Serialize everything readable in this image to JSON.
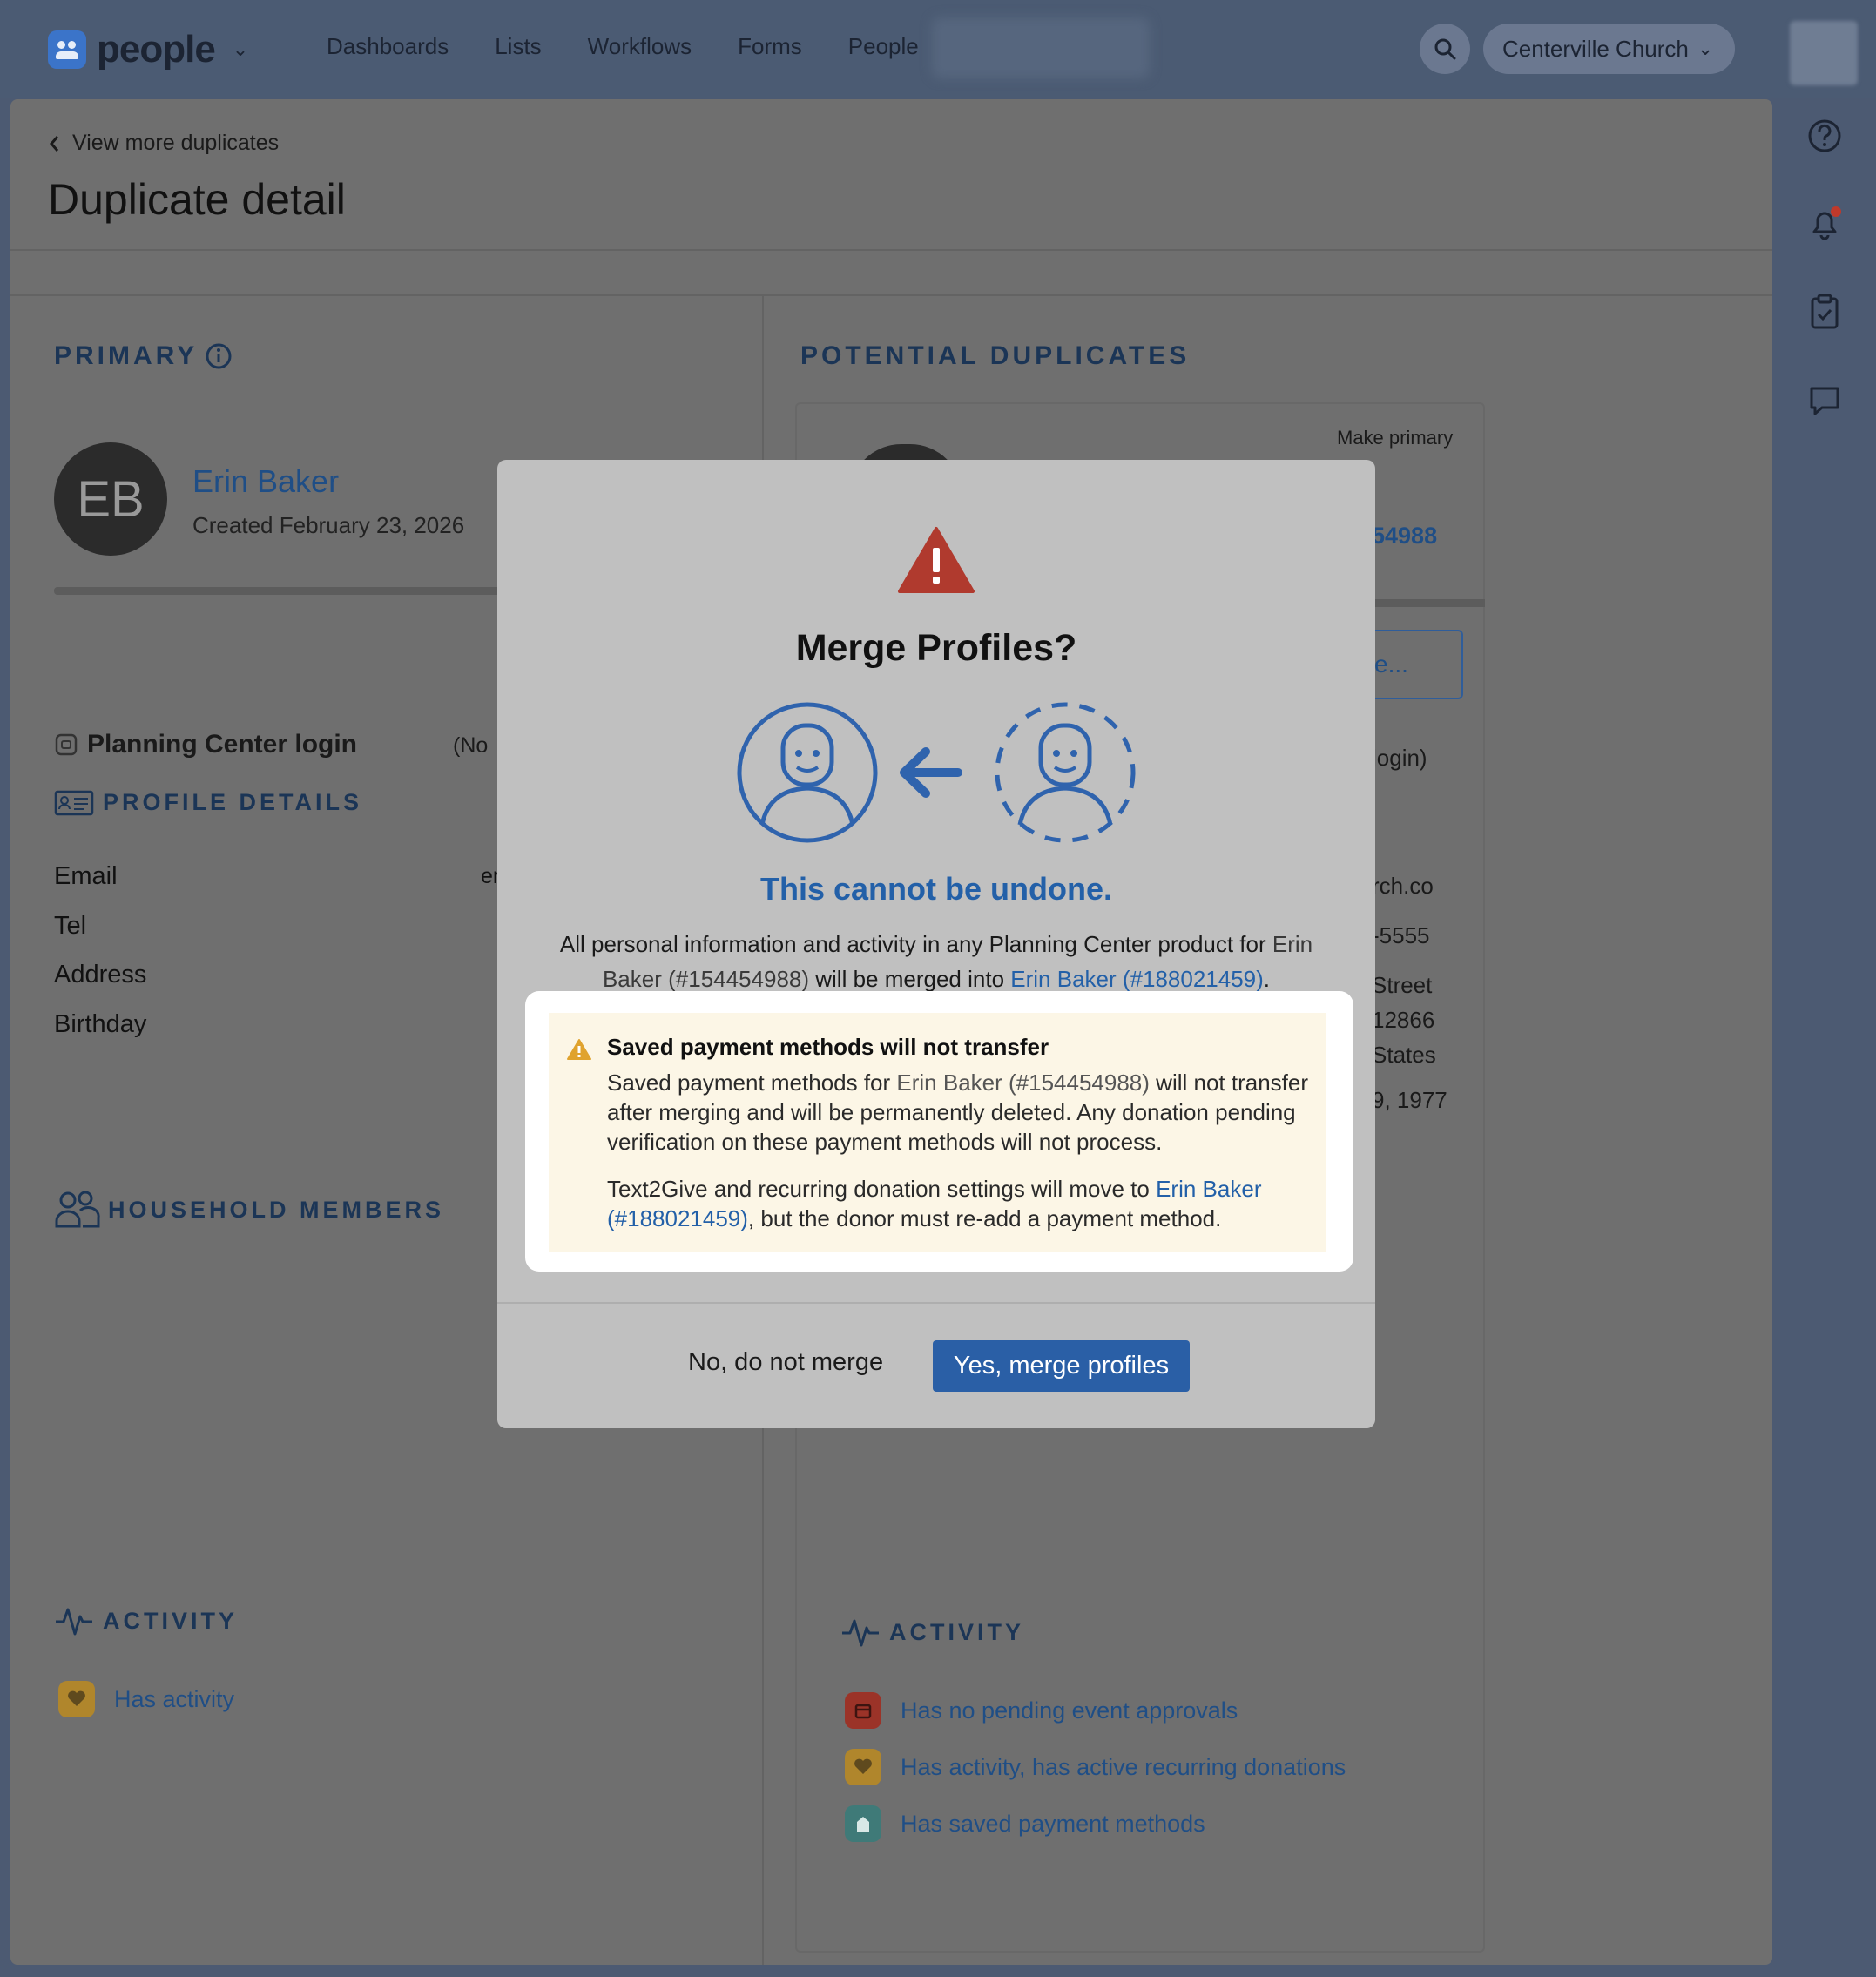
{
  "topbar": {
    "app_name": "people",
    "nav": [
      "Dashboards",
      "Lists",
      "Workflows",
      "Forms",
      "People"
    ],
    "org": "Centerville Church"
  },
  "breadcrumb": "View more duplicates",
  "page_title": "Duplicate detail",
  "primary": {
    "section": "PRIMARY",
    "initials": "EB",
    "name": "Erin Baker",
    "created": "Created February 23, 2026",
    "login_label": "Planning Center login",
    "login_value": "(No",
    "profile_details": "PROFILE DETAILS",
    "fields": [
      "Email",
      "Tel",
      "Address",
      "Birthday"
    ],
    "email_partial": "er",
    "household": "HOUSEHOLD MEMBERS",
    "activity": "ACTIVITY",
    "activity_items": [
      "Has activity"
    ]
  },
  "duplicates": {
    "section": "POTENTIAL DUPLICATES",
    "make_primary": "Make primary",
    "id_partial": "54988",
    "button_partial": "e...",
    "login_partial": "login)",
    "email_partial": "rch.co",
    "tel_partial": "-5555",
    "addr1": "Street",
    "addr2": "12866",
    "addr3": "States",
    "birthday_partial": "9, 1977",
    "activity": "ACTIVITY",
    "activity_items": [
      "Has no pending event approvals",
      "Has activity, has active recurring donations",
      "Has saved payment methods"
    ]
  },
  "modal": {
    "title": "Merge Profiles?",
    "undone": "This cannot be undone.",
    "body_pre": "All personal information and activity in any Planning Center product for ",
    "body_from": "Erin Baker (#154454988)",
    "body_mid": " will be merged into ",
    "body_to": "Erin Baker (#188021459)",
    "body_end": ".",
    "notice_title": "Saved payment methods will not transfer",
    "notice_p1_pre": "Saved payment methods for ",
    "notice_p1_name": "Erin Baker (#154454988)",
    "notice_p1_post": " will not transfer after merging and will be permanently deleted. Any donation pending verification on these payment methods will not process.",
    "notice_p2_pre": "Text2Give and recurring donation settings will move to ",
    "notice_p2_link": "Erin Baker (#188021459)",
    "notice_p2_post": ", but the donor must re-add a payment method.",
    "cancel": "No, do not merge",
    "confirm": "Yes, merge profiles"
  },
  "colors": {
    "accent": "#2360a8",
    "warning": "#b03a2e",
    "notice_bg": "#fcf6e6"
  }
}
